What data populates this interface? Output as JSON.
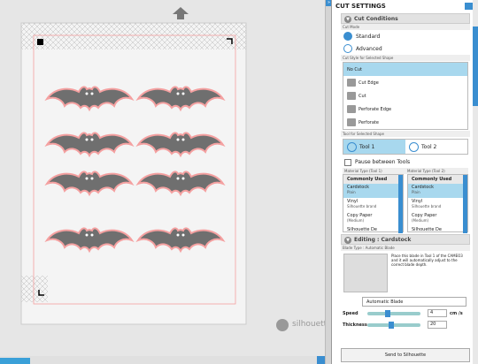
{
  "panel": {
    "title": "CUT SETTINGS",
    "cut_conditions": {
      "header": "Cut Conditions",
      "cut_mode_label": "Cut Mode",
      "mode_standard": "Standard",
      "mode_advanced": "Advanced",
      "cut_style_label": "Cut Style for Selected Shape",
      "styles": [
        "No Cut",
        "Cut Edge",
        "Cut",
        "Perforate Edge",
        "Perforate"
      ],
      "tool_label": "Tool for Selected Shape",
      "tool1": "Tool 1",
      "tool2": "Tool 2",
      "pause": "Pause between Tools",
      "mat1_label": "Material Type (Tool 1)",
      "mat2_label": "Material Type (Tool 2)",
      "commonly_used": "Commonly Used",
      "materials": [
        {
          "name": "Cardstock",
          "sub": "Plain"
        },
        {
          "name": "Vinyl",
          "sub": "Silhouette brand"
        },
        {
          "name": "Copy Paper",
          "sub": "(Medium)"
        },
        {
          "name": "Silhouette De",
          "sub": ""
        }
      ]
    },
    "editing": {
      "header": "Editing : Cardstock",
      "blade_type": "Blade Type : Automatic Blade",
      "blade_text": "Place this blade in Tool 1 of the CAMEO3 and it will automatically adjust to the correct blade depth.",
      "blade_select": "Automatic Blade",
      "speed_label": "Speed",
      "speed_value": "4",
      "speed_unit": "cm /s",
      "thickness_label": "Thickness",
      "thickness_value": "20"
    },
    "send_button": "Send to Silhouette"
  },
  "canvas": {
    "brand": "silhouette",
    "accent": "#3a8ed0",
    "bat_fill": "#6f6f6f",
    "bat_outline": "#f4a0a0"
  }
}
